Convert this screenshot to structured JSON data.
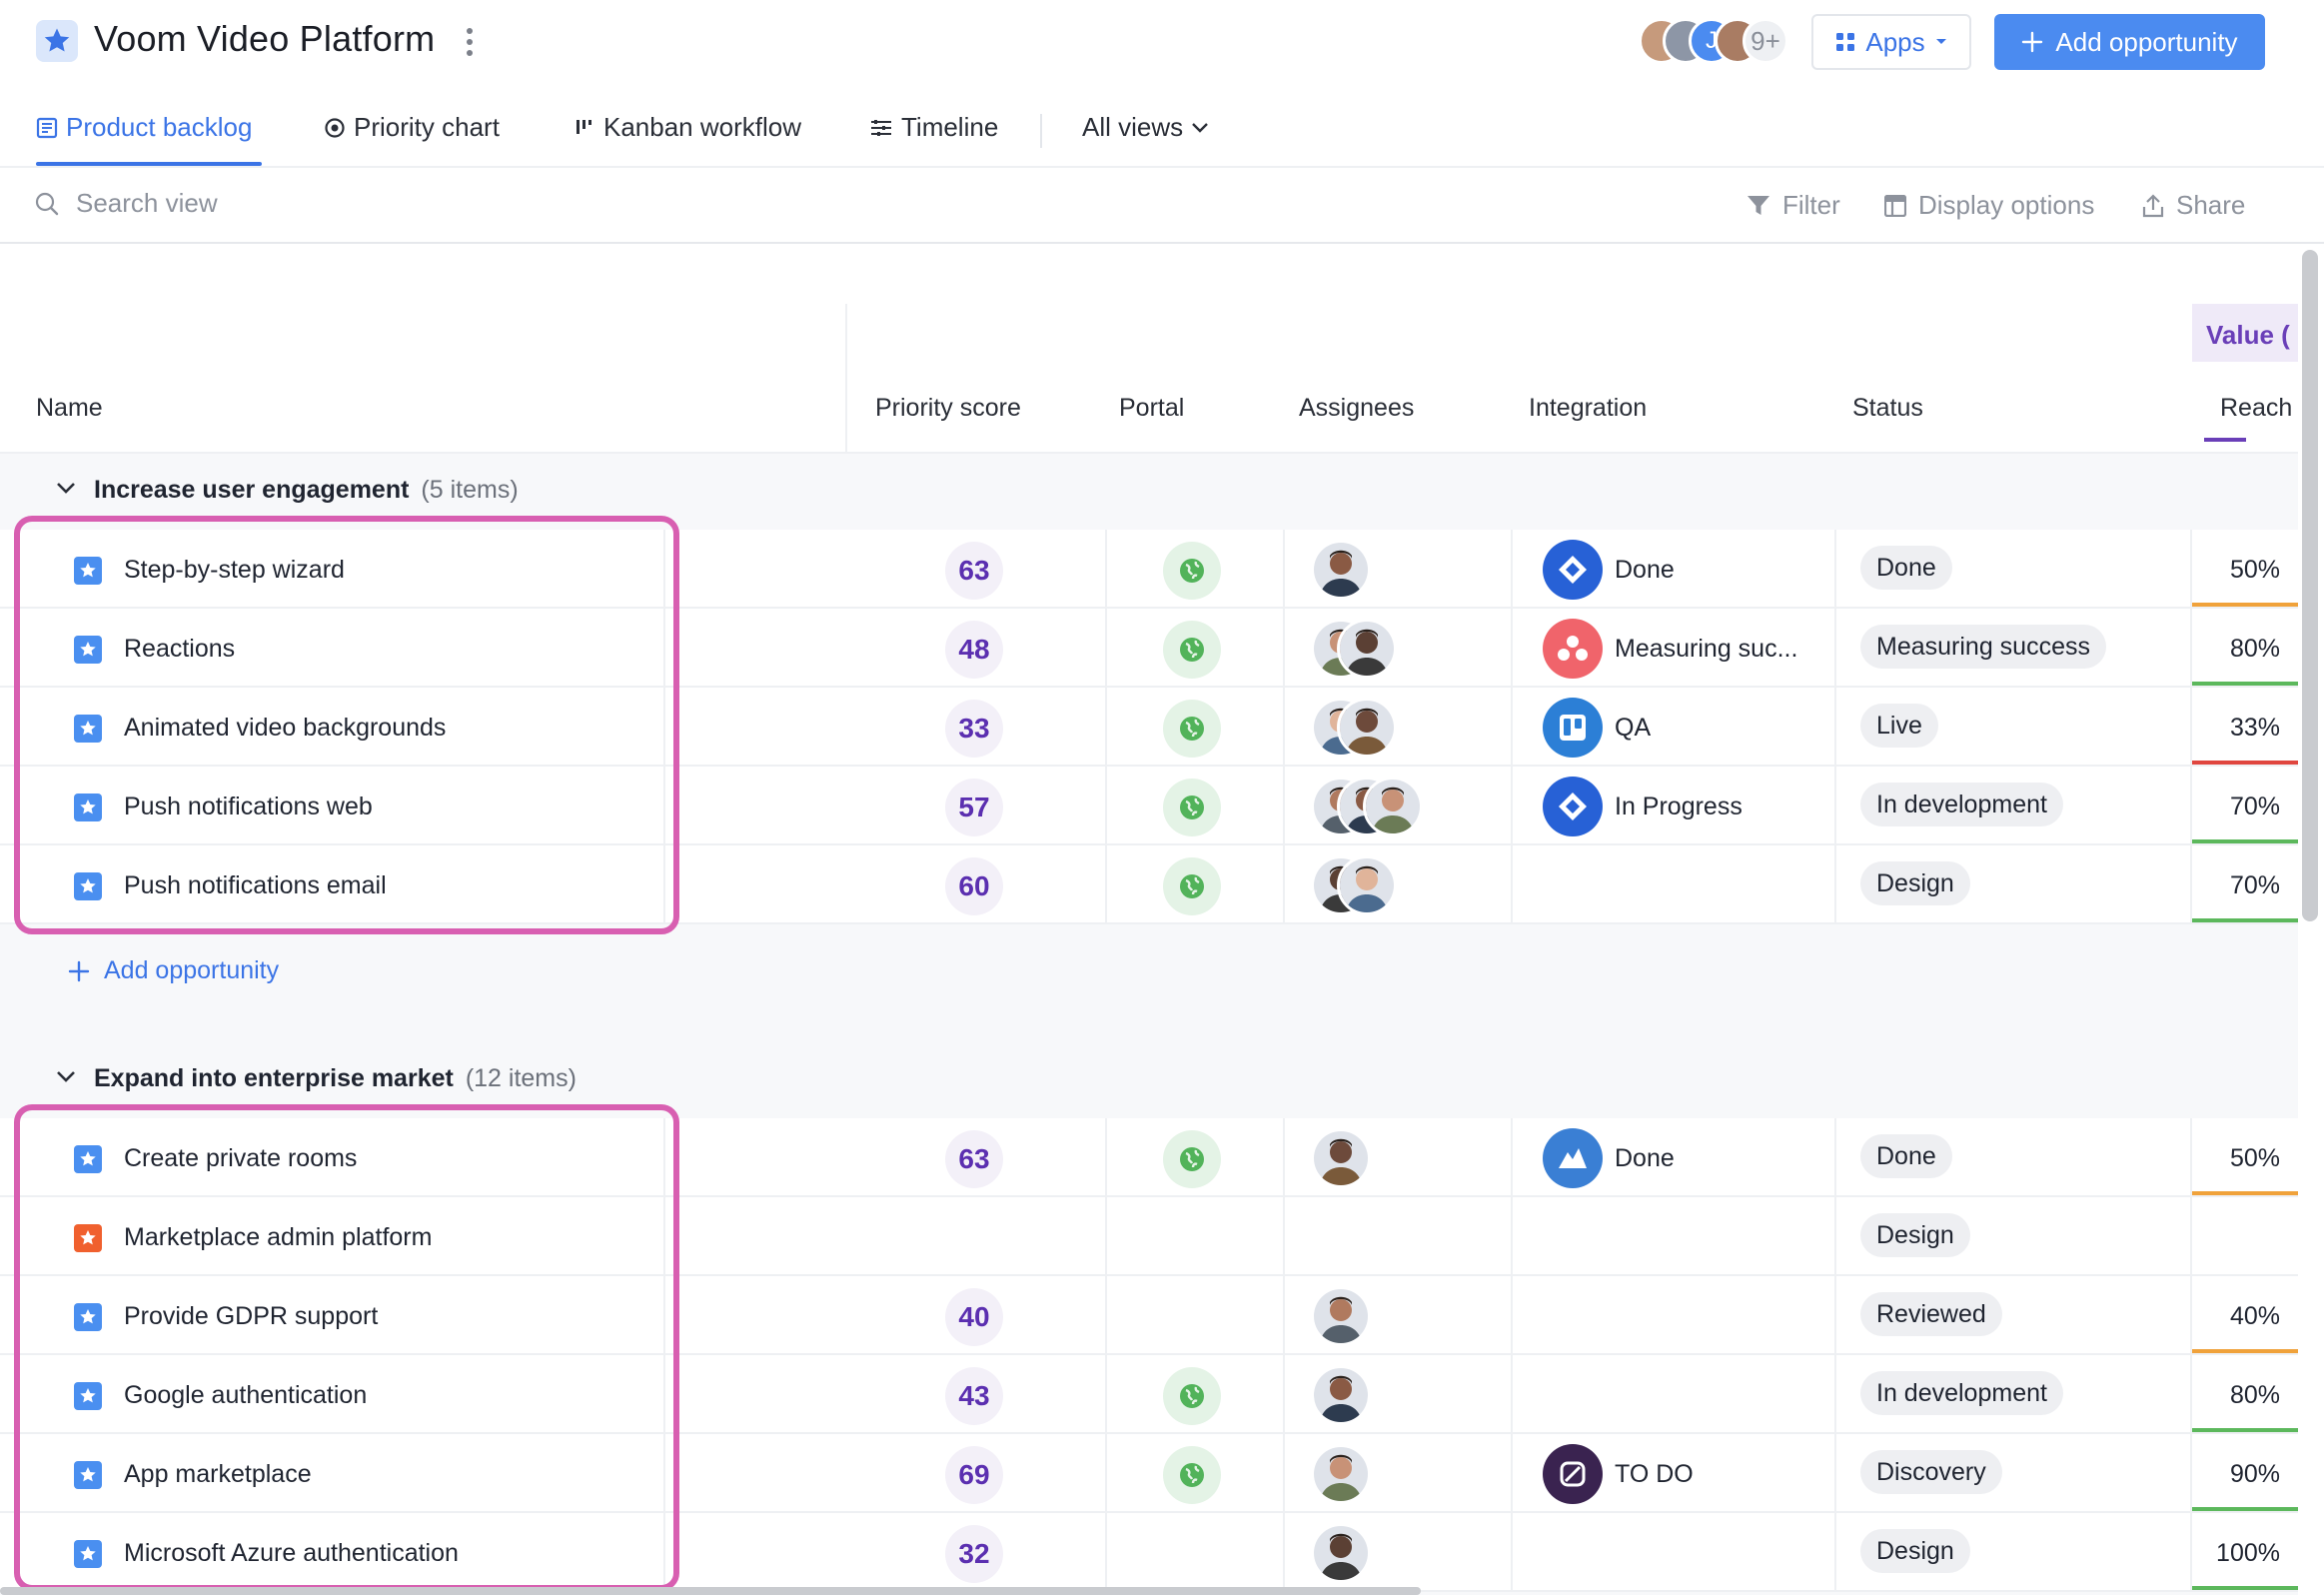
{
  "header": {
    "title": "Voom Video Platform",
    "collaborators_more": "9+",
    "apps_label": "Apps",
    "add_opportunity_label": "Add opportunity",
    "accent": "#3b74e6",
    "button_color": "#4b8bf0"
  },
  "tabs": [
    {
      "label": "Product backlog",
      "icon": "list-icon",
      "active": true
    },
    {
      "label": "Priority chart",
      "icon": "target-icon"
    },
    {
      "label": "Kanban workflow",
      "icon": "kanban-icon"
    },
    {
      "label": "Timeline",
      "icon": "timeline-icon"
    },
    {
      "label": "All views",
      "icon": "chevron-down-icon"
    }
  ],
  "toolbar": {
    "search_placeholder": "Search view",
    "filter": "Filter",
    "display_options": "Display options",
    "share": "Share"
  },
  "columns": {
    "name": "Name",
    "priority_score": "Priority score",
    "portal": "Portal",
    "assignees": "Assignees",
    "integration": "Integration",
    "status": "Status",
    "value_group": "Value (",
    "reach": "Reach"
  },
  "groups": [
    {
      "title": "Increase user engagement",
      "count": "(5 items)",
      "add_label": "Add opportunity",
      "rows": [
        {
          "name": "Step-by-step wizard",
          "score": "63",
          "portal": true,
          "assignees": 1,
          "integration": {
            "icon": "jira-icon",
            "text": "Done"
          },
          "status": "Done",
          "reach": "50%",
          "reach_color": "#f0a23b"
        },
        {
          "name": "Reactions",
          "score": "48",
          "portal": true,
          "assignees": 2,
          "integration": {
            "icon": "asana-icon",
            "text": "Measuring suc..."
          },
          "status": "Measuring success",
          "reach": "80%",
          "reach_color": "#5cb85c"
        },
        {
          "name": "Animated video backgrounds",
          "score": "33",
          "portal": true,
          "assignees": 2,
          "integration": {
            "icon": "trello-icon",
            "text": "QA"
          },
          "status": "Live",
          "reach": "33%",
          "reach_color": "#e0463f"
        },
        {
          "name": "Push notifications web",
          "score": "57",
          "portal": true,
          "assignees": 3,
          "integration": {
            "icon": "jira-icon",
            "text": "In Progress"
          },
          "status": "In development",
          "reach": "70%",
          "reach_color": "#5cb85c"
        },
        {
          "name": "Push notifications email",
          "score": "60",
          "portal": true,
          "assignees": 2,
          "integration": null,
          "status": "Design",
          "reach": "70%",
          "reach_color": "#5cb85c"
        }
      ]
    },
    {
      "title": "Expand into enterprise market",
      "count": "(12 items)",
      "rows": [
        {
          "name": "Create private rooms",
          "score": "63",
          "portal": true,
          "assignees": 1,
          "integration": {
            "icon": "azure-devops-icon",
            "text": "Done"
          },
          "status": "Done",
          "reach": "50%",
          "reach_color": "#f0a23b"
        },
        {
          "name": "Marketplace admin platform",
          "score": "",
          "portal": false,
          "assignees": 0,
          "integration": null,
          "status": "Design",
          "reach": "",
          "reach_color": ""
        },
        {
          "name": "Provide GDPR support",
          "score": "40",
          "portal": false,
          "assignees": 1,
          "integration": null,
          "status": "Reviewed",
          "reach": "40%",
          "reach_color": "#f0a23b"
        },
        {
          "name": "Google authentication",
          "score": "43",
          "portal": true,
          "assignees": 1,
          "integration": null,
          "status": "In development",
          "reach": "80%",
          "reach_color": "#5cb85c"
        },
        {
          "name": "App marketplace",
          "score": "69",
          "portal": true,
          "assignees": 1,
          "integration": {
            "icon": "shortcut-icon",
            "text": "TO DO"
          },
          "status": "Discovery",
          "reach": "90%",
          "reach_color": "#5cb85c"
        },
        {
          "name": "Microsoft Azure authentication",
          "score": "32",
          "portal": false,
          "assignees": 1,
          "integration": null,
          "status": "Design",
          "reach": "100%",
          "reach_color": "#5cb85c"
        }
      ]
    }
  ]
}
